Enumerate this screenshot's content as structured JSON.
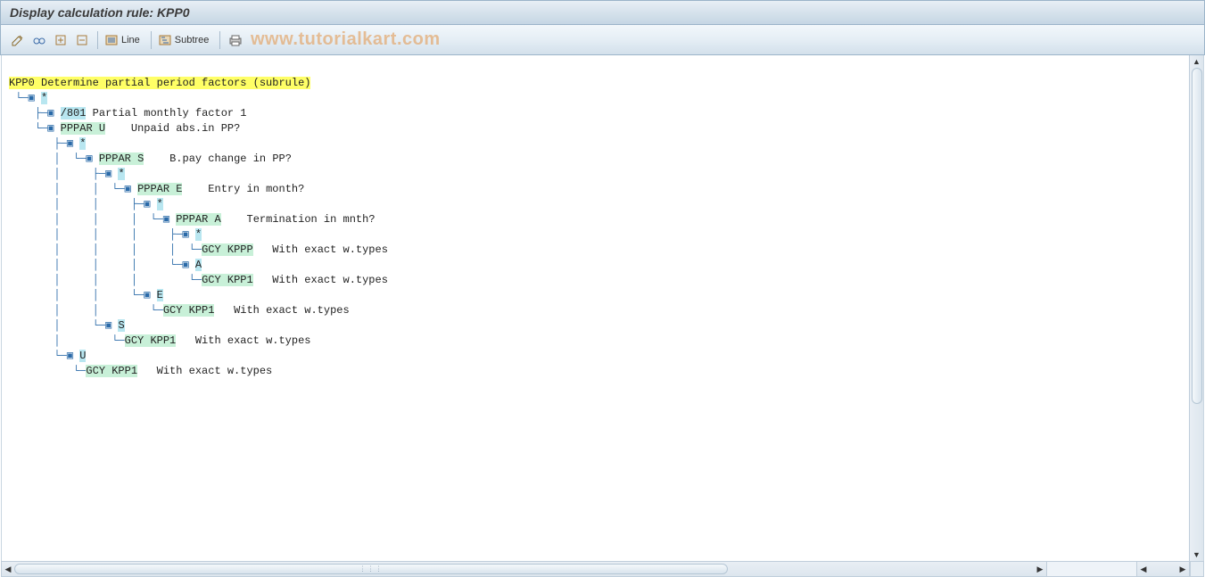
{
  "title": "Display calculation rule: KPP0",
  "watermark": "www.tutorialkart.com",
  "toolbar": {
    "line_label": "Line",
    "subtree_label": "Subtree"
  },
  "tree": {
    "root_code": "KPP0",
    "root_desc": "Determine partial period factors (subrule)",
    "l1_star": "*",
    "l2_code": "/801",
    "l2_desc": "Partial monthly factor 1",
    "l3_op": "PPPAR U",
    "l3_desc": "Unpaid abs.in PP?",
    "l4_star": "*",
    "l5_op": "PPPAR S",
    "l5_desc": "B.pay change in PP?",
    "l6_star": "*",
    "l7_op": "PPPAR E",
    "l7_desc": "Entry in month?",
    "l8_star": "*",
    "l9_op": "PPPAR A",
    "l9_desc": "Termination in mnth?",
    "l10_star": "*",
    "l11_op": "GCY KPPP",
    "l11_desc": "With exact w.types",
    "l10_a": "A",
    "l12_op": "GCY KPP1",
    "l12_desc": "With exact w.types",
    "l8_e": "E",
    "l13_op": "GCY KPP1",
    "l13_desc": "With exact w.types",
    "l6_s": "S",
    "l14_op": "GCY KPP1",
    "l14_desc": "With exact w.types",
    "l4_u": "U",
    "l15_op": "GCY KPP1",
    "l15_desc": "With exact w.types"
  }
}
